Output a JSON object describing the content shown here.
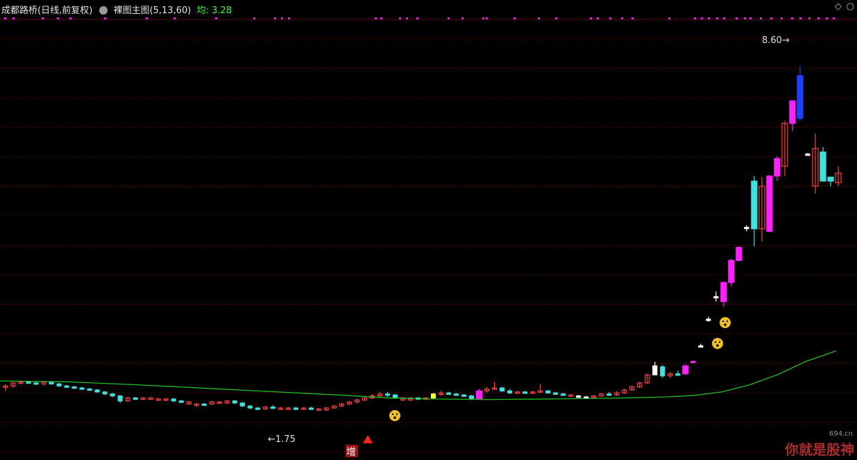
{
  "header": {
    "stock": "成都路桥(日线,前复权)",
    "indicator": "裸图主图(5,13,60)",
    "avg_label": "均: 3.28"
  },
  "corner_icons": [
    "diamond-icon",
    "circle-icon"
  ],
  "watermark": {
    "text": "你就是股神",
    "domain": "694.cn"
  },
  "chart_data": {
    "type": "candlestick",
    "ylim": [
      1.2,
      9.3
    ],
    "grid": "dotted-red-horizontal",
    "gridlines": [
      0.0,
      0.58,
      1.15,
      1.73,
      2.3,
      2.88,
      3.45,
      4.03,
      4.6,
      5.18,
      5.75,
      6.33,
      6.9,
      7.48,
      8.05,
      8.63,
      9.2
    ],
    "high_label": "8.60",
    "low_label": "1.75",
    "candles": [
      {
        "o": 2.2,
        "h": 2.25,
        "l": 2.12,
        "c": 2.22,
        "t": "up"
      },
      {
        "o": 2.22,
        "h": 2.3,
        "l": 2.18,
        "c": 2.28,
        "t": "up"
      },
      {
        "o": 2.28,
        "h": 2.32,
        "l": 2.25,
        "c": 2.3,
        "t": "up"
      },
      {
        "o": 2.3,
        "h": 2.32,
        "l": 2.26,
        "c": 2.28,
        "t": "dn"
      },
      {
        "o": 2.28,
        "h": 2.3,
        "l": 2.24,
        "c": 2.26,
        "t": "dn"
      },
      {
        "o": 2.26,
        "h": 2.32,
        "l": 2.22,
        "c": 2.3,
        "t": "up"
      },
      {
        "o": 2.3,
        "h": 2.32,
        "l": 2.24,
        "c": 2.26,
        "t": "dn"
      },
      {
        "o": 2.26,
        "h": 2.28,
        "l": 2.2,
        "c": 2.22,
        "t": "dn"
      },
      {
        "o": 2.22,
        "h": 2.24,
        "l": 2.18,
        "c": 2.2,
        "t": "dn"
      },
      {
        "o": 2.2,
        "h": 2.22,
        "l": 2.16,
        "c": 2.18,
        "t": "dn"
      },
      {
        "o": 2.18,
        "h": 2.2,
        "l": 2.14,
        "c": 2.16,
        "t": "dn"
      },
      {
        "o": 2.16,
        "h": 2.18,
        "l": 2.12,
        "c": 2.14,
        "t": "dn"
      },
      {
        "o": 2.14,
        "h": 2.16,
        "l": 2.08,
        "c": 2.1,
        "t": "dn"
      },
      {
        "o": 2.1,
        "h": 2.12,
        "l": 2.04,
        "c": 2.06,
        "t": "dn"
      },
      {
        "o": 2.06,
        "h": 2.08,
        "l": 2.0,
        "c": 2.02,
        "t": "dn"
      },
      {
        "o": 2.02,
        "h": 2.04,
        "l": 1.88,
        "c": 1.92,
        "t": "dn"
      },
      {
        "o": 1.92,
        "h": 2.0,
        "l": 1.9,
        "c": 1.98,
        "t": "up"
      },
      {
        "o": 1.98,
        "h": 2.0,
        "l": 1.94,
        "c": 1.96,
        "t": "dn"
      },
      {
        "o": 1.96,
        "h": 2.0,
        "l": 1.94,
        "c": 1.98,
        "t": "up"
      },
      {
        "o": 1.98,
        "h": 2.0,
        "l": 1.94,
        "c": 1.96,
        "t": "up"
      },
      {
        "o": 1.96,
        "h": 1.98,
        "l": 1.92,
        "c": 1.94,
        "t": "up"
      },
      {
        "o": 1.94,
        "h": 1.98,
        "l": 1.92,
        "c": 1.96,
        "t": "up"
      },
      {
        "o": 1.96,
        "h": 1.98,
        "l": 1.9,
        "c": 1.92,
        "t": "dn"
      },
      {
        "o": 1.92,
        "h": 1.94,
        "l": 1.88,
        "c": 1.9,
        "t": "dn"
      },
      {
        "o": 1.9,
        "h": 1.92,
        "l": 1.84,
        "c": 1.86,
        "t": "up"
      },
      {
        "o": 1.86,
        "h": 1.88,
        "l": 1.8,
        "c": 1.84,
        "t": "up"
      },
      {
        "o": 1.84,
        "h": 1.88,
        "l": 1.82,
        "c": 1.86,
        "t": "dn"
      },
      {
        "o": 1.86,
        "h": 1.92,
        "l": 1.84,
        "c": 1.9,
        "t": "up"
      },
      {
        "o": 1.9,
        "h": 1.92,
        "l": 1.86,
        "c": 1.88,
        "t": "up"
      },
      {
        "o": 1.88,
        "h": 1.94,
        "l": 1.86,
        "c": 1.92,
        "t": "up"
      },
      {
        "o": 1.92,
        "h": 1.94,
        "l": 1.86,
        "c": 1.88,
        "t": "dn"
      },
      {
        "o": 1.88,
        "h": 1.9,
        "l": 1.8,
        "c": 1.82,
        "t": "dn"
      },
      {
        "o": 1.82,
        "h": 1.84,
        "l": 1.76,
        "c": 1.78,
        "t": "dn"
      },
      {
        "o": 1.78,
        "h": 1.8,
        "l": 1.74,
        "c": 1.76,
        "t": "dn"
      },
      {
        "o": 1.76,
        "h": 1.82,
        "l": 1.75,
        "c": 1.8,
        "t": "up"
      },
      {
        "o": 1.8,
        "h": 1.84,
        "l": 1.76,
        "c": 1.78,
        "t": "dn"
      },
      {
        "o": 1.78,
        "h": 1.8,
        "l": 1.74,
        "c": 1.76,
        "t": "up"
      },
      {
        "o": 1.76,
        "h": 1.8,
        "l": 1.74,
        "c": 1.78,
        "t": "up"
      },
      {
        "o": 1.78,
        "h": 1.8,
        "l": 1.74,
        "c": 1.76,
        "t": "dn"
      },
      {
        "o": 1.76,
        "h": 1.8,
        "l": 1.74,
        "c": 1.78,
        "t": "up"
      },
      {
        "o": 1.78,
        "h": 1.8,
        "l": 1.74,
        "c": 1.76,
        "t": "dn"
      },
      {
        "o": 1.76,
        "h": 1.78,
        "l": 1.72,
        "c": 1.74,
        "t": "up"
      },
      {
        "o": 1.74,
        "h": 1.8,
        "l": 1.72,
        "c": 1.78,
        "t": "up"
      },
      {
        "o": 1.78,
        "h": 1.84,
        "l": 1.76,
        "c": 1.82,
        "t": "up"
      },
      {
        "o": 1.82,
        "h": 1.88,
        "l": 1.8,
        "c": 1.86,
        "t": "up"
      },
      {
        "o": 1.86,
        "h": 1.92,
        "l": 1.84,
        "c": 1.9,
        "t": "up"
      },
      {
        "o": 1.9,
        "h": 1.96,
        "l": 1.88,
        "c": 1.94,
        "t": "up"
      },
      {
        "o": 1.94,
        "h": 2.0,
        "l": 1.92,
        "c": 1.98,
        "t": "up"
      },
      {
        "o": 1.98,
        "h": 2.06,
        "l": 1.96,
        "c": 2.02,
        "t": "up"
      },
      {
        "o": 2.02,
        "h": 2.1,
        "l": 2.0,
        "c": 2.06,
        "t": "up"
      },
      {
        "o": 2.06,
        "h": 2.1,
        "l": 2.0,
        "c": 2.04,
        "t": "dn"
      },
      {
        "o": 2.04,
        "h": 2.06,
        "l": 1.96,
        "c": 1.98,
        "t": "dn"
      },
      {
        "o": 1.98,
        "h": 2.0,
        "l": 1.92,
        "c": 1.94,
        "t": "up"
      },
      {
        "o": 1.94,
        "h": 2.0,
        "l": 1.92,
        "c": 1.98,
        "t": "up"
      },
      {
        "o": 1.98,
        "h": 2.0,
        "l": 1.94,
        "c": 1.96,
        "t": "dn"
      },
      {
        "o": 1.96,
        "h": 2.0,
        "l": 1.94,
        "c": 1.98,
        "t": "up"
      },
      {
        "o": 1.98,
        "h": 2.08,
        "l": 1.96,
        "c": 2.06,
        "t": "yl"
      },
      {
        "o": 2.06,
        "h": 2.12,
        "l": 2.02,
        "c": 2.08,
        "t": "up"
      },
      {
        "o": 2.08,
        "h": 2.1,
        "l": 2.04,
        "c": 2.06,
        "t": "dn"
      },
      {
        "o": 2.06,
        "h": 2.08,
        "l": 2.02,
        "c": 2.04,
        "t": "dn"
      },
      {
        "o": 2.04,
        "h": 2.06,
        "l": 2.0,
        "c": 2.02,
        "t": "dn"
      },
      {
        "o": 2.02,
        "h": 2.04,
        "l": 1.94,
        "c": 1.96,
        "t": "dn"
      },
      {
        "o": 1.96,
        "h": 2.16,
        "l": 1.94,
        "c": 2.12,
        "t": "mg"
      },
      {
        "o": 2.12,
        "h": 2.2,
        "l": 2.08,
        "c": 2.16,
        "t": "up"
      },
      {
        "o": 2.16,
        "h": 2.3,
        "l": 2.14,
        "c": 2.18,
        "t": "up"
      },
      {
        "o": 2.18,
        "h": 2.2,
        "l": 2.1,
        "c": 2.12,
        "t": "dn"
      },
      {
        "o": 2.12,
        "h": 2.16,
        "l": 2.06,
        "c": 2.08,
        "t": "dn"
      },
      {
        "o": 2.08,
        "h": 2.12,
        "l": 2.06,
        "c": 2.1,
        "t": "up"
      },
      {
        "o": 2.1,
        "h": 2.12,
        "l": 2.06,
        "c": 2.08,
        "t": "dn"
      },
      {
        "o": 2.08,
        "h": 2.12,
        "l": 2.06,
        "c": 2.1,
        "t": "up"
      },
      {
        "o": 2.1,
        "h": 2.26,
        "l": 2.08,
        "c": 2.12,
        "t": "up"
      },
      {
        "o": 2.12,
        "h": 2.14,
        "l": 2.06,
        "c": 2.08,
        "t": "dn"
      },
      {
        "o": 2.08,
        "h": 2.1,
        "l": 2.04,
        "c": 2.06,
        "t": "dn"
      },
      {
        "o": 2.06,
        "h": 2.08,
        "l": 2.02,
        "c": 2.04,
        "t": "dn"
      },
      {
        "o": 2.04,
        "h": 2.06,
        "l": 2.0,
        "c": 2.02,
        "t": "up"
      },
      {
        "o": 2.02,
        "h": 2.04,
        "l": 1.98,
        "c": 2.0,
        "t": "wt"
      },
      {
        "o": 2.0,
        "h": 2.02,
        "l": 1.98,
        "c": 2.0,
        "t": "wt"
      },
      {
        "o": 2.0,
        "h": 2.04,
        "l": 1.98,
        "c": 2.02,
        "t": "up"
      },
      {
        "o": 2.02,
        "h": 2.08,
        "l": 2.0,
        "c": 2.06,
        "t": "up"
      },
      {
        "o": 2.06,
        "h": 2.1,
        "l": 2.02,
        "c": 2.04,
        "t": "dn"
      },
      {
        "o": 2.04,
        "h": 2.12,
        "l": 2.02,
        "c": 2.08,
        "t": "up"
      },
      {
        "o": 2.08,
        "h": 2.16,
        "l": 2.06,
        "c": 2.14,
        "t": "up"
      },
      {
        "o": 2.14,
        "h": 2.22,
        "l": 2.12,
        "c": 2.2,
        "t": "up"
      },
      {
        "o": 2.2,
        "h": 2.3,
        "l": 2.18,
        "c": 2.28,
        "t": "up"
      },
      {
        "o": 2.28,
        "h": 2.46,
        "l": 2.26,
        "c": 2.44,
        "t": "up"
      },
      {
        "o": 2.44,
        "h": 2.7,
        "l": 2.58,
        "c": 2.62,
        "t": "wt2"
      },
      {
        "o": 2.6,
        "h": 2.64,
        "l": 2.38,
        "c": 2.42,
        "t": "dn"
      },
      {
        "o": 2.42,
        "h": 2.5,
        "l": 2.38,
        "c": 2.46,
        "t": "up"
      },
      {
        "o": 2.46,
        "h": 2.52,
        "l": 2.42,
        "c": 2.44,
        "t": "dn"
      },
      {
        "o": 2.46,
        "h": 2.66,
        "l": 2.44,
        "c": 2.62,
        "t": "mg"
      },
      {
        "o": 2.7,
        "h": 2.72,
        "l": 2.7,
        "c": 2.71,
        "t": "mgline"
      },
      {
        "o": 3.02,
        "h": 3.06,
        "l": 3.0,
        "c": 3.02,
        "t": "wt"
      },
      {
        "o": 3.55,
        "h": 3.6,
        "l": 3.5,
        "c": 3.55,
        "t": "wt"
      },
      {
        "o": 4.0,
        "h": 4.1,
        "l": 3.9,
        "c": 4.0,
        "t": "wt"
      },
      {
        "o": 3.9,
        "h": 4.3,
        "l": 3.8,
        "c": 4.28,
        "t": "mg"
      },
      {
        "o": 4.28,
        "h": 4.75,
        "l": 4.2,
        "c": 4.72,
        "t": "mg"
      },
      {
        "o": 4.72,
        "h": 5.0,
        "l": 4.7,
        "c": 4.98,
        "t": "mg"
      },
      {
        "o": 5.38,
        "h": 5.42,
        "l": 5.3,
        "c": 5.38,
        "t": "wt2"
      },
      {
        "o": 5.35,
        "h": 6.4,
        "l": 5.0,
        "c": 6.3,
        "t": "cy"
      },
      {
        "o": 6.2,
        "h": 6.38,
        "l": 5.1,
        "c": 5.35,
        "t": "up"
      },
      {
        "o": 5.3,
        "h": 6.42,
        "l": 5.28,
        "c": 6.4,
        "t": "mg"
      },
      {
        "o": 6.4,
        "h": 6.8,
        "l": 6.3,
        "c": 6.75,
        "t": "mg"
      },
      {
        "o": 6.6,
        "h": 7.5,
        "l": 6.4,
        "c": 7.45,
        "t": "up"
      },
      {
        "o": 7.45,
        "h": 7.9,
        "l": 7.3,
        "c": 7.9,
        "t": "mg"
      },
      {
        "o": 7.55,
        "h": 8.6,
        "l": 7.5,
        "c": 8.4,
        "t": "bl"
      },
      {
        "o": 6.84,
        "h": 6.86,
        "l": 6.82,
        "c": 6.84,
        "t": "wt"
      },
      {
        "o": 6.2,
        "h": 7.25,
        "l": 6.05,
        "c": 6.95,
        "t": "up"
      },
      {
        "o": 6.3,
        "h": 6.98,
        "l": 6.55,
        "c": 6.88,
        "t": "cy"
      },
      {
        "o": 6.38,
        "h": 6.38,
        "l": 6.2,
        "c": 6.3,
        "t": "cy"
      },
      {
        "o": 6.27,
        "h": 6.6,
        "l": 6.2,
        "c": 6.46,
        "t": "up"
      }
    ],
    "ma60": [
      [
        0,
        2.32
      ],
      [
        100,
        2.3
      ],
      [
        200,
        2.24
      ],
      [
        300,
        2.17
      ],
      [
        400,
        2.1
      ],
      [
        500,
        2.03
      ],
      [
        560,
        1.98
      ],
      [
        620,
        1.96
      ],
      [
        700,
        1.95
      ],
      [
        800,
        1.96
      ],
      [
        900,
        1.98
      ],
      [
        960,
        2.0
      ],
      [
        1000,
        2.03
      ],
      [
        1040,
        2.1
      ],
      [
        1080,
        2.24
      ],
      [
        1120,
        2.44
      ],
      [
        1160,
        2.7
      ],
      [
        1205,
        2.92
      ]
    ]
  },
  "markers": {
    "zeng_label": "增",
    "top_markers_x": [
      6,
      18,
      60,
      82,
      100,
      150,
      210,
      250,
      310,
      365,
      395,
      405,
      415,
      540,
      548,
      575,
      585,
      600,
      645,
      665,
      695,
      700,
      740,
      775,
      800,
      850,
      860,
      878,
      895,
      910,
      963,
      1000,
      1010,
      1020,
      1032,
      1042,
      1060,
      1072,
      1080,
      1095,
      1110,
      1125,
      1140,
      1152,
      1165,
      1178,
      1190,
      1200
    ]
  }
}
